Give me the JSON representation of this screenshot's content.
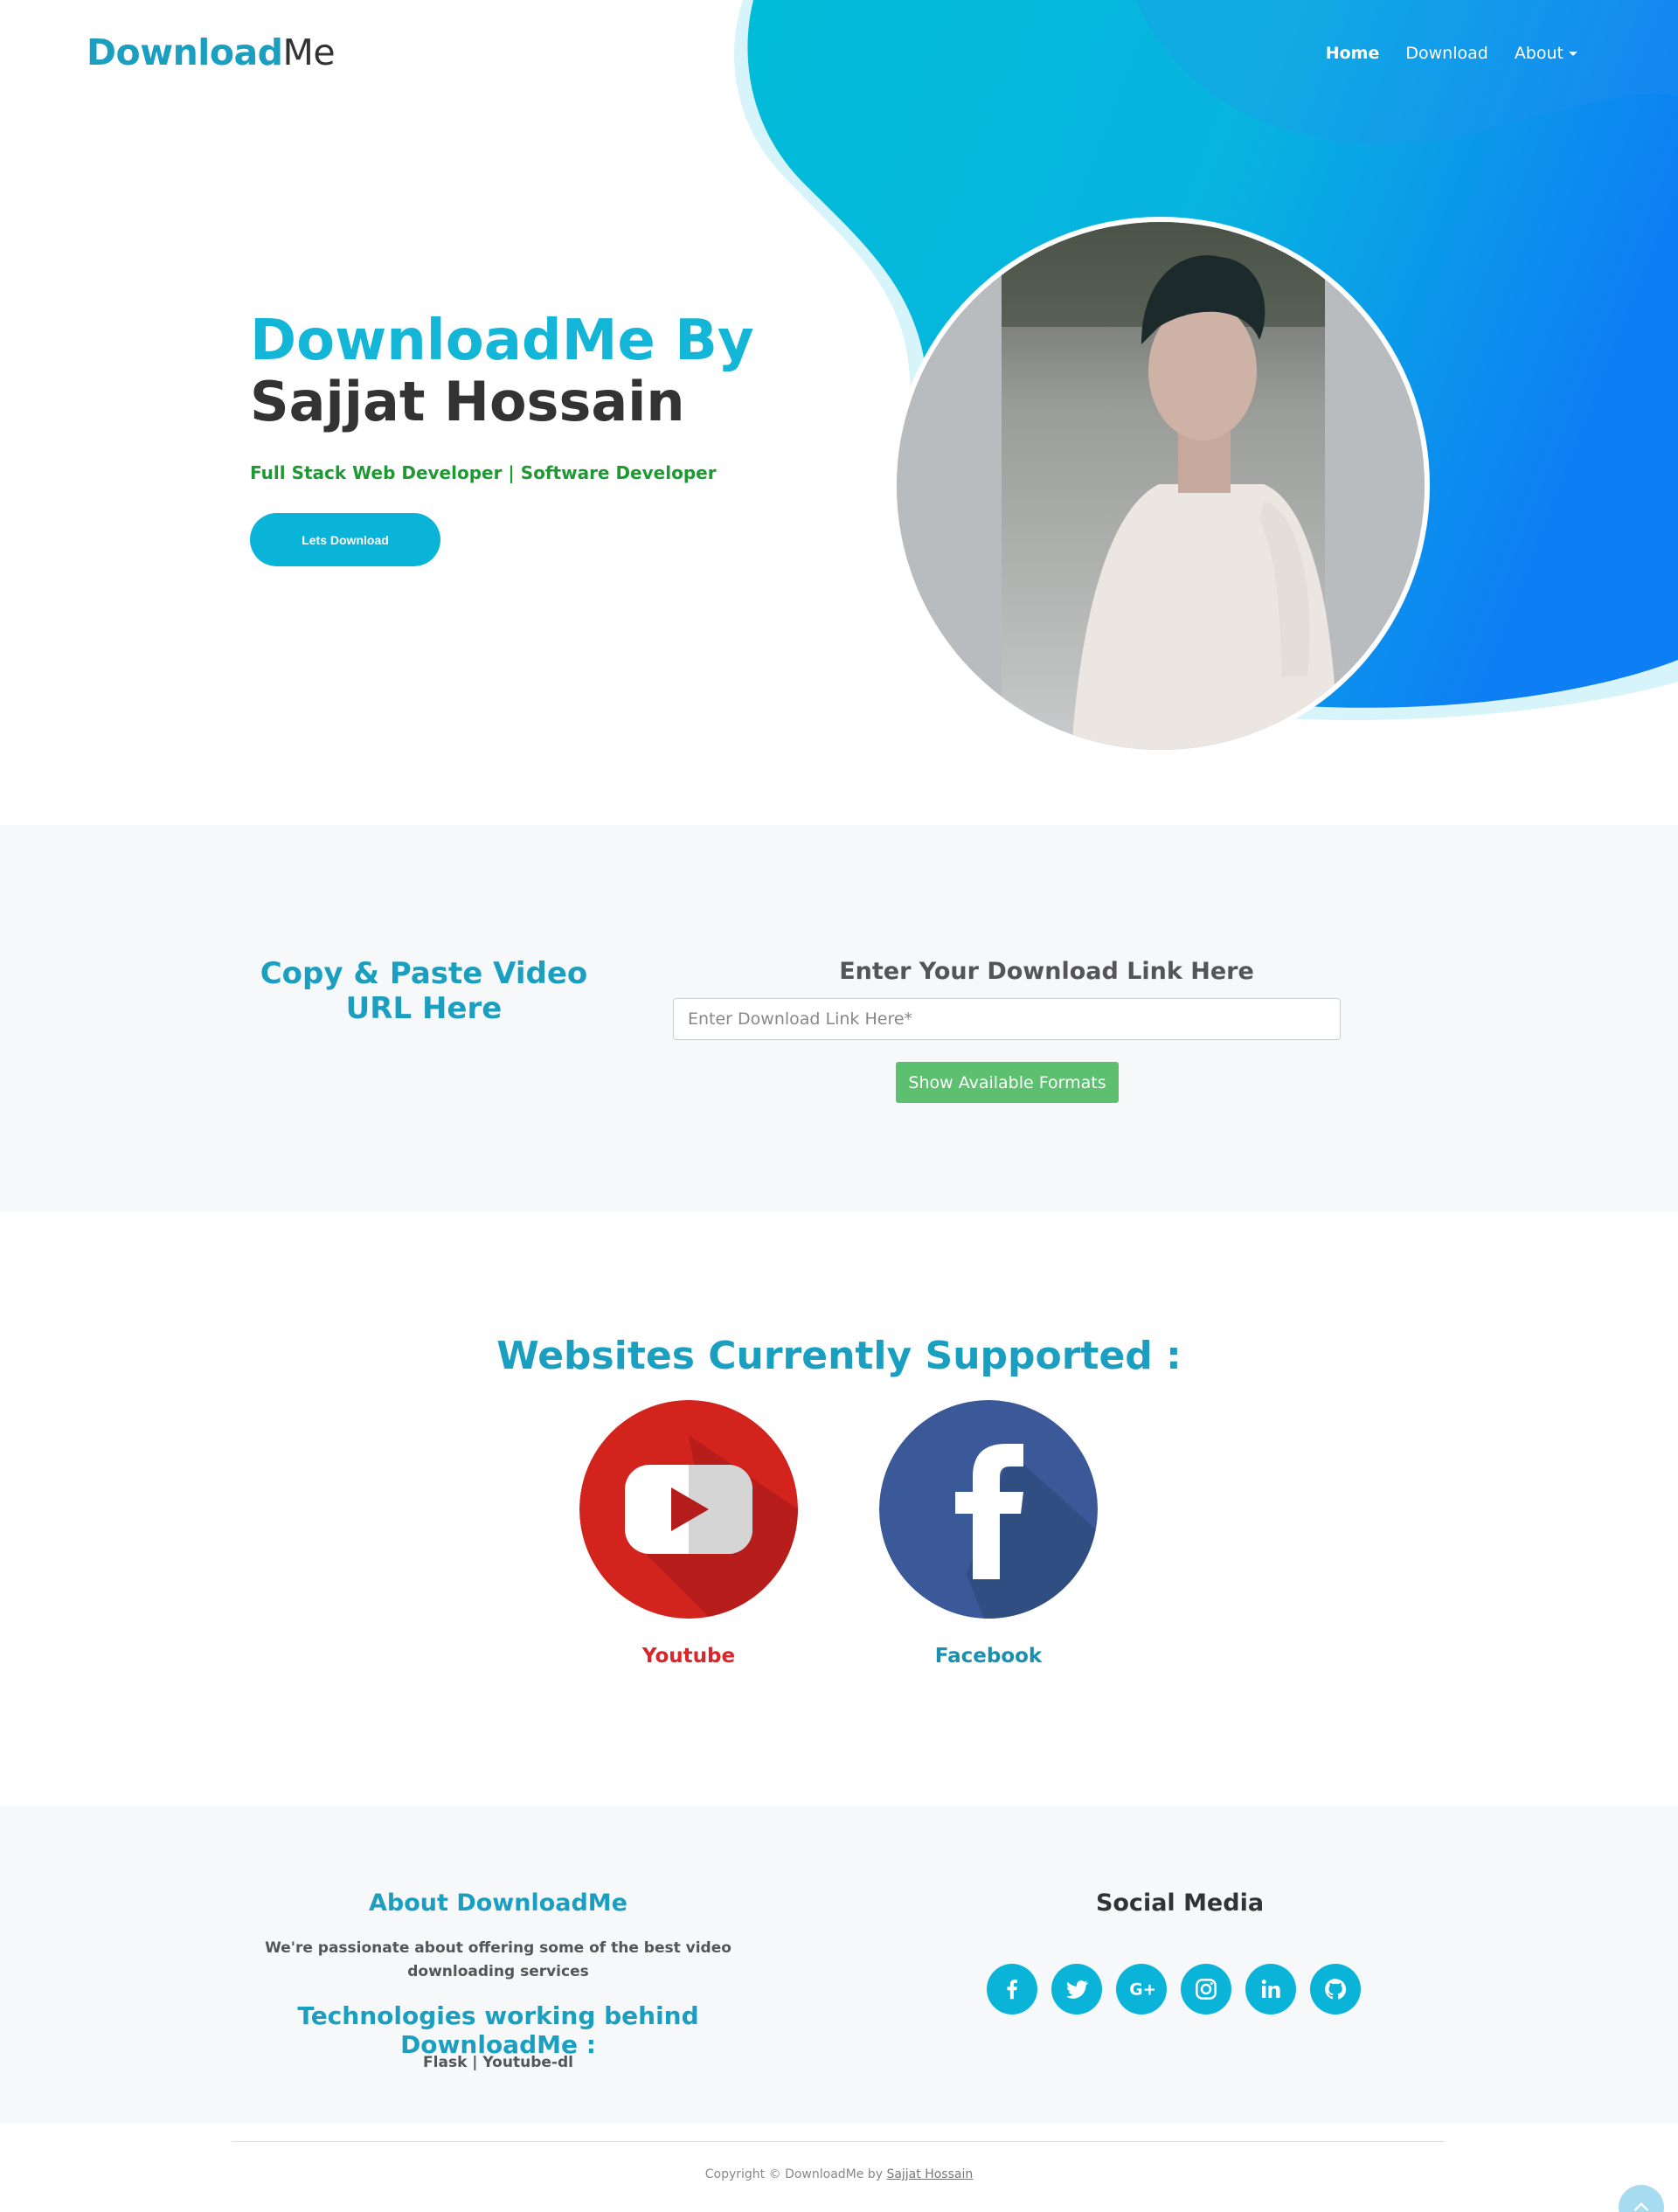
{
  "brand": {
    "part1": "Download",
    "part2": "Me"
  },
  "nav": {
    "home": "Home",
    "download": "Download",
    "about": "About"
  },
  "hero": {
    "title_line1": "DownloadMe By",
    "title_line2": "Sajjat Hossain",
    "subtitle": "Full Stack Web Developer | Software Developer",
    "cta_label": "Lets Download"
  },
  "url_section": {
    "left_title": "Copy & Paste Video URL Here",
    "right_title": "Enter Your Download Link Here",
    "input_placeholder": "Enter Download Link Here*",
    "button_label": "Show Available Formats"
  },
  "supported": {
    "title": "Websites Currently Supported :",
    "sites": [
      {
        "label": "Youtube",
        "color": "#d9262a"
      },
      {
        "label": "Facebook",
        "color": "#1b8fae"
      }
    ]
  },
  "footer": {
    "about_title": "About DownloadMe",
    "about_text": "We're passionate about offering some of the best video downloading services",
    "tech_title": "Technologies working behind DownloadMe :",
    "tech_text": "Flask | Youtube-dl",
    "social_title": "Social Media",
    "social_icons": [
      "facebook-icon",
      "twitter-icon",
      "google-plus-icon",
      "instagram-icon",
      "linkedin-icon",
      "github-icon"
    ]
  },
  "copyright": {
    "prefix": "Copyright © DownloadMe by",
    "author": "Sajjat Hossain"
  },
  "colors": {
    "accent": "#0ab4d9",
    "brand": "#1b9fc0",
    "green": "#1e9a33",
    "button_green": "#5cc070"
  }
}
